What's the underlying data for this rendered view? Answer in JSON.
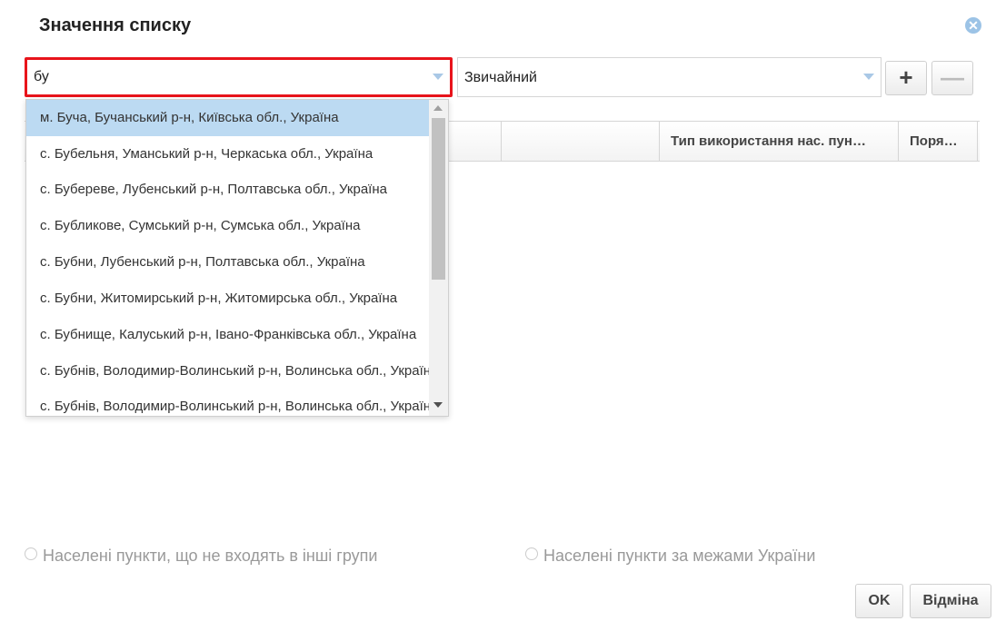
{
  "dialog": {
    "title": "Значення списку",
    "close_icon": "close-icon"
  },
  "filter": {
    "search_value": "бу",
    "type_value": "Звичайний"
  },
  "toolbar": {
    "add_label": "+",
    "remove_label": "—"
  },
  "grid": {
    "columns": [
      "",
      "",
      "Тип використання нас. пун…",
      "Поря…"
    ]
  },
  "dropdown": {
    "options": [
      "м. Буча, Бучанський р-н, Київська обл., Україна",
      "с. Бубельня, Уманський р-н, Черкаська обл., Україна",
      "с. Бубереве, Лубенський р-н, Полтавська обл., Україна",
      "с. Бубликове, Сумський р-н, Сумська обл., Україна",
      "с. Бубни, Лубенський р-н, Полтавська обл., Україна",
      "с. Бубни, Житомирський р-н, Житомирська обл., Україна",
      "с. Бубнище, Калуський р-н, Івано-Франківська обл., Україна",
      "с. Бубнів, Володимир-Волинський р-н, Волинська обл., Україна",
      "с. Бубнів, Володимир-Волинський р-н, Волинська обл., Україна"
    ],
    "selected_index": 0
  },
  "radios": {
    "not_in_groups": "Населені пункти, що не входять в інші групи",
    "outside_ukraine": "Населені пункти за межами України"
  },
  "footer": {
    "ok_label": "OK",
    "cancel_label": "Відміна"
  },
  "colors": {
    "highlight_border": "#e8141b",
    "selected_option": "#bcdaf2",
    "accent": "#9cc3e6"
  }
}
